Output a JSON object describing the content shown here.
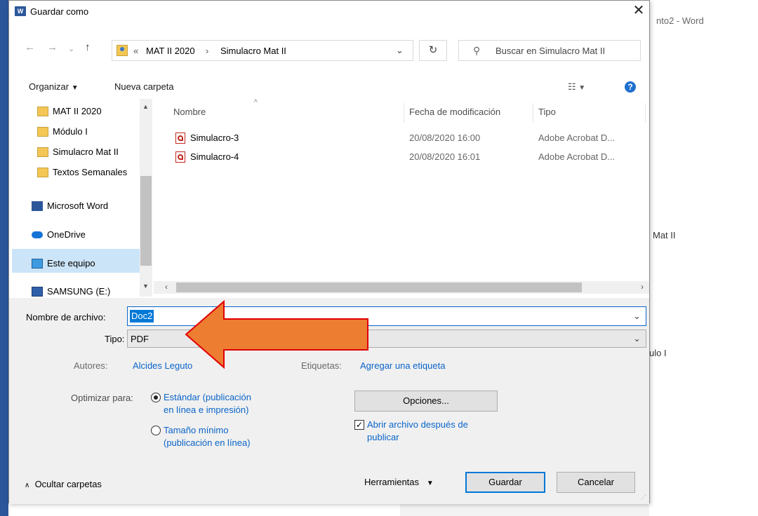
{
  "background": {
    "window_title": "nto2 - Word",
    "side_text_1": "Mat II",
    "side_text_2": "ulo I"
  },
  "dialog": {
    "title": "Guardar como",
    "address": {
      "prefix": "«",
      "crumbs": [
        "MAT II 2020",
        "Simulacro Mat II"
      ],
      "separator": "›"
    },
    "search_placeholder": "Buscar en Simulacro Mat II",
    "toolbar": {
      "organize": "Organizar",
      "new_folder": "Nueva carpeta"
    },
    "nav_items": [
      {
        "label": "MAT II 2020",
        "icon": "sync-folder-icon"
      },
      {
        "label": "Módulo I",
        "icon": "folder-icon"
      },
      {
        "label": "Simulacro Mat II",
        "icon": "synced-folder-icon"
      },
      {
        "label": "Textos Semanales",
        "icon": "synced-folder-icon"
      },
      {
        "label": "Microsoft Word",
        "icon": "word-icon"
      },
      {
        "label": "OneDrive",
        "icon": "cloud-icon"
      },
      {
        "label": "Este equipo",
        "icon": "computer-icon"
      },
      {
        "label": "SAMSUNG (E:)",
        "icon": "drive-icon"
      }
    ],
    "columns": {
      "name": "Nombre",
      "date": "Fecha de modificación",
      "type": "Tipo"
    },
    "files": [
      {
        "name": "Simulacro-3",
        "date": "20/08/2020 16:00",
        "type": "Adobe Acrobat D..."
      },
      {
        "name": "Simulacro-4",
        "date": "20/08/2020 16:01",
        "type": "Adobe Acrobat D..."
      }
    ],
    "filename_label": "Nombre de archivo:",
    "filename_value": "Doc2",
    "type_label": "Tipo:",
    "type_value": "PDF",
    "authors_label": "Autores:",
    "authors_value": "Alcides Leguto",
    "tags_label": "Etiquetas:",
    "tags_value": "Agregar una etiqueta",
    "optimize_label": "Optimizar para:",
    "opt_standard_1": "Estándar (publicación",
    "opt_standard_2": "en línea e impresión)",
    "opt_min_1": "Tamaño mínimo",
    "opt_min_2": "(publicación en línea)",
    "options_button": "Opciones...",
    "open_after_1": "Abrir archivo después de",
    "open_after_2": "publicar",
    "hide_folders": "Ocultar carpetas",
    "tools": "Herramientas",
    "save": "Guardar",
    "cancel": "Cancelar"
  },
  "colors": {
    "word_blue": "#2b579a",
    "link_blue": "#0a64c8",
    "arrow_fill": "#ed7d31",
    "arrow_stroke": "#e00000",
    "selection": "#cce4f7"
  }
}
